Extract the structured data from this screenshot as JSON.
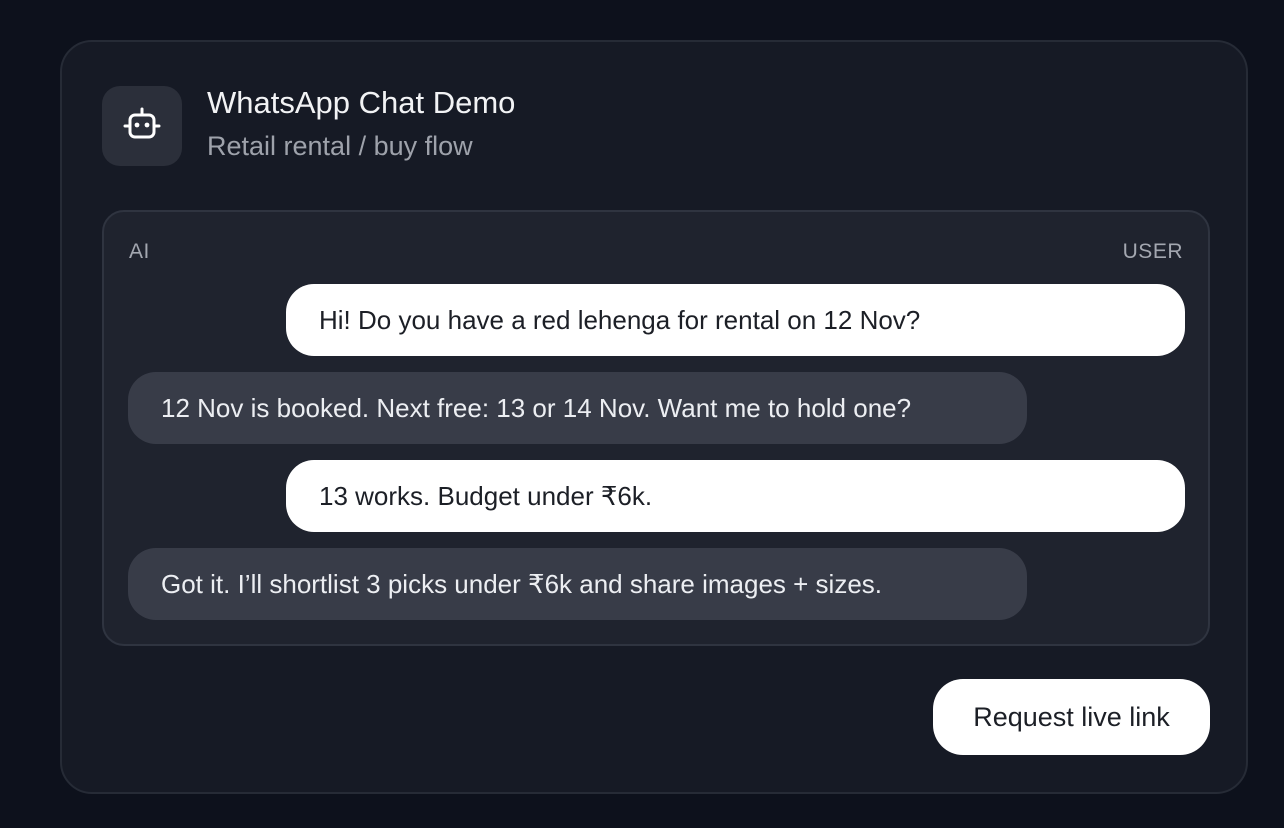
{
  "header": {
    "icon": "robot-icon",
    "title": "WhatsApp Chat Demo",
    "subtitle": "Retail rental / buy flow"
  },
  "chat": {
    "label_ai": "AI",
    "label_user": "USER",
    "messages": [
      {
        "sender": "user",
        "text": "Hi! Do you have a red lehenga for rental on 12 Nov?"
      },
      {
        "sender": "ai",
        "text": "12 Nov is booked. Next free: 13 or 14 Nov. Want me to hold one?"
      },
      {
        "sender": "user",
        "text": "13 works. Budget under ₹6k."
      },
      {
        "sender": "ai",
        "text": "Got it. I’ll shortlist 3 picks under ₹6k and share images + sizes."
      }
    ]
  },
  "actions": {
    "request_live_link": "Request live link"
  },
  "colors": {
    "page_background": "#0d111c",
    "card_background": "#161a25",
    "user_bubble": "#ffffff",
    "ai_bubble": "#383c48"
  }
}
